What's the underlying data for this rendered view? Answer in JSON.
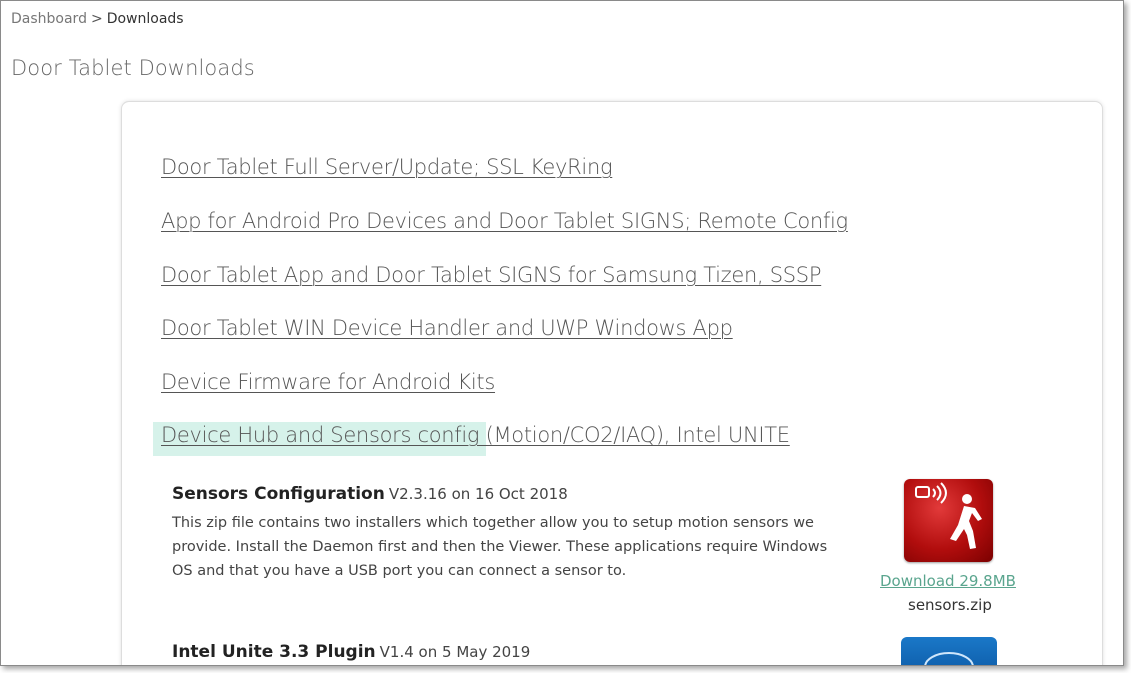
{
  "breadcrumb": {
    "dashboard": "Dashboard",
    "separator": ">",
    "current": "Downloads"
  },
  "page_title": "Door Tablet Downloads",
  "links": [
    "Door Tablet Full Server/Update; SSL KeyRing",
    "App for Android Pro Devices and Door Tablet SIGNS; Remote Config",
    "Door Tablet App and Door Tablet SIGNS for Samsung Tizen, SSSP",
    "Door Tablet WIN Device Handler and UWP Windows App",
    "Device Firmware for Android Kits",
    "Device Hub and Sensors config (Motion/CO2/IAQ), Intel UNITE"
  ],
  "items": [
    {
      "title": "Sensors Configuration",
      "meta": "V2.3.16 on 16 Oct 2018",
      "description": "This zip file contains two installers which together allow you to setup motion sensors we provide. Install the Daemon first and then the Viewer. These applications require Windows OS and that you have a USB port you can connect a sensor to.",
      "icon": "motion-sensor-icon",
      "download_label": "Download 29.8MB",
      "filename": "sensors.zip"
    },
    {
      "title": "Intel Unite 3.3 Plugin",
      "meta": "V1.4 on 5 May 2019",
      "icon": "intel-icon"
    }
  ],
  "colors": {
    "highlight": "#d6f2ea",
    "download_link": "#5aa58e",
    "sensor_icon_bg": "#c41414",
    "intel_icon_bg": "#1a78c8"
  }
}
